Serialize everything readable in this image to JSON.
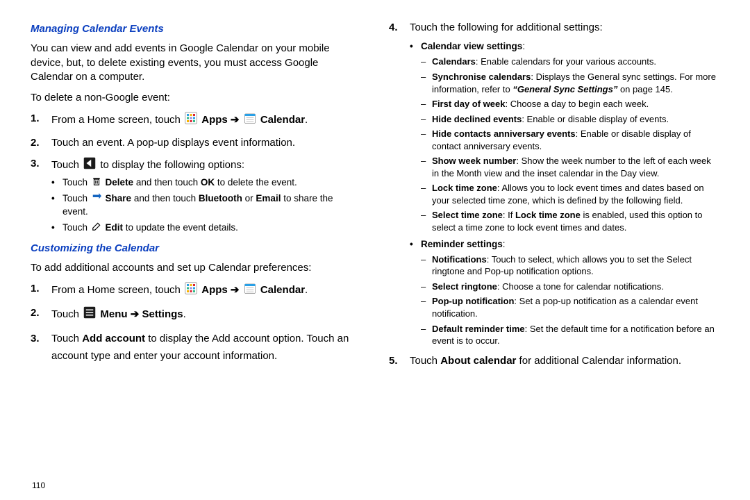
{
  "page_number": "110",
  "arrow": "➔",
  "left": {
    "h1": "Managing Calendar Events",
    "p1": "You can view and add events in Google Calendar on your mobile device, but, to delete existing events, you must access Google Calendar on a computer.",
    "p2": "To delete a non-Google event:",
    "s1": {
      "n": "1.",
      "pre": "From a Home screen, touch ",
      "apps": "Apps",
      "cal": "Calendar",
      "post": "."
    },
    "s2": {
      "n": "2.",
      "t": "Touch an event. A pop-up displays event information."
    },
    "s3": {
      "n": "3.",
      "pre": "Touch ",
      "post": " to display the following options:"
    },
    "s3a": {
      "pre": "Touch ",
      "b": "Delete",
      "mid": " and then touch ",
      "b2": "OK",
      "post": " to delete the event."
    },
    "s3b": {
      "pre": "Touch ",
      "b": "Share",
      "mid": " and then touch ",
      "b2": "Bluetooth",
      "or": " or ",
      "b3": "Email",
      "post": " to share the event."
    },
    "s3c": {
      "pre": "Touch ",
      "b": "Edit",
      "post": " to update the event details."
    },
    "h2": "Customizing the Calendar",
    "p3": "To add additional accounts and set up Calendar preferences:",
    "c1": {
      "n": "1.",
      "pre": "From a Home screen, touch ",
      "apps": "Apps",
      "cal": "Calendar",
      "post": "."
    },
    "c2": {
      "n": "2.",
      "pre": "Touch ",
      "menu": "Menu",
      "set": "Settings",
      "post": "."
    },
    "c3": {
      "n": "3.",
      "pre": "Touch ",
      "b": "Add account",
      "post": " to display the Add account option. Touch an account type and enter your account information."
    }
  },
  "right": {
    "s4": {
      "n": "4.",
      "t": "Touch the following for additional settings:"
    },
    "g1": {
      "head": "Calendar view settings",
      "colon": ":"
    },
    "i1": {
      "b": "Calendars",
      "t": ": Enable calendars for your various accounts."
    },
    "i2": {
      "b": "Synchronise calendars",
      "t": ": Displays the General sync settings. For more information, refer to ",
      "ref": "“General Sync Settings”",
      "t2": "  on page 145."
    },
    "i3": {
      "b": "First day of week",
      "t": ": Choose a day to begin each week."
    },
    "i4": {
      "b": "Hide declined events",
      "t": ": Enable or disable display of events."
    },
    "i5": {
      "b": "Hide contacts anniversary events",
      "t": ": Enable or disable display of contact anniversary events."
    },
    "i6": {
      "b": "Show week number",
      "t": ": Show the week number to the left of each week in the Month view and the inset calendar in the Day view."
    },
    "i7": {
      "b": "Lock time zone",
      "t": ": Allows you to lock event times and dates based on your selected time zone, which is defined by the following field."
    },
    "i8": {
      "b": "Select time zone",
      "pre": ": If ",
      "b2": "Lock time zone",
      "t": " is enabled, used this option to select a time zone to lock event times and dates."
    },
    "g2": {
      "head": "Reminder settings",
      "colon": ":"
    },
    "r1": {
      "b": "Notifications",
      "t": ": Touch to select, which allows you to set the Select ringtone and Pop-up notification options."
    },
    "r2": {
      "b": "Select ringtone",
      "t": ": Choose a tone for calendar notifications."
    },
    "r3": {
      "b": "Pop-up notification",
      "t": ": Set a pop-up notification as a calendar event notification."
    },
    "r4": {
      "b": "Default reminder time",
      "t": ": Set the default time for a notification before an event is to occur."
    },
    "s5": {
      "n": "5.",
      "pre": "Touch ",
      "b": "About calendar",
      "post": " for additional Calendar information."
    }
  }
}
